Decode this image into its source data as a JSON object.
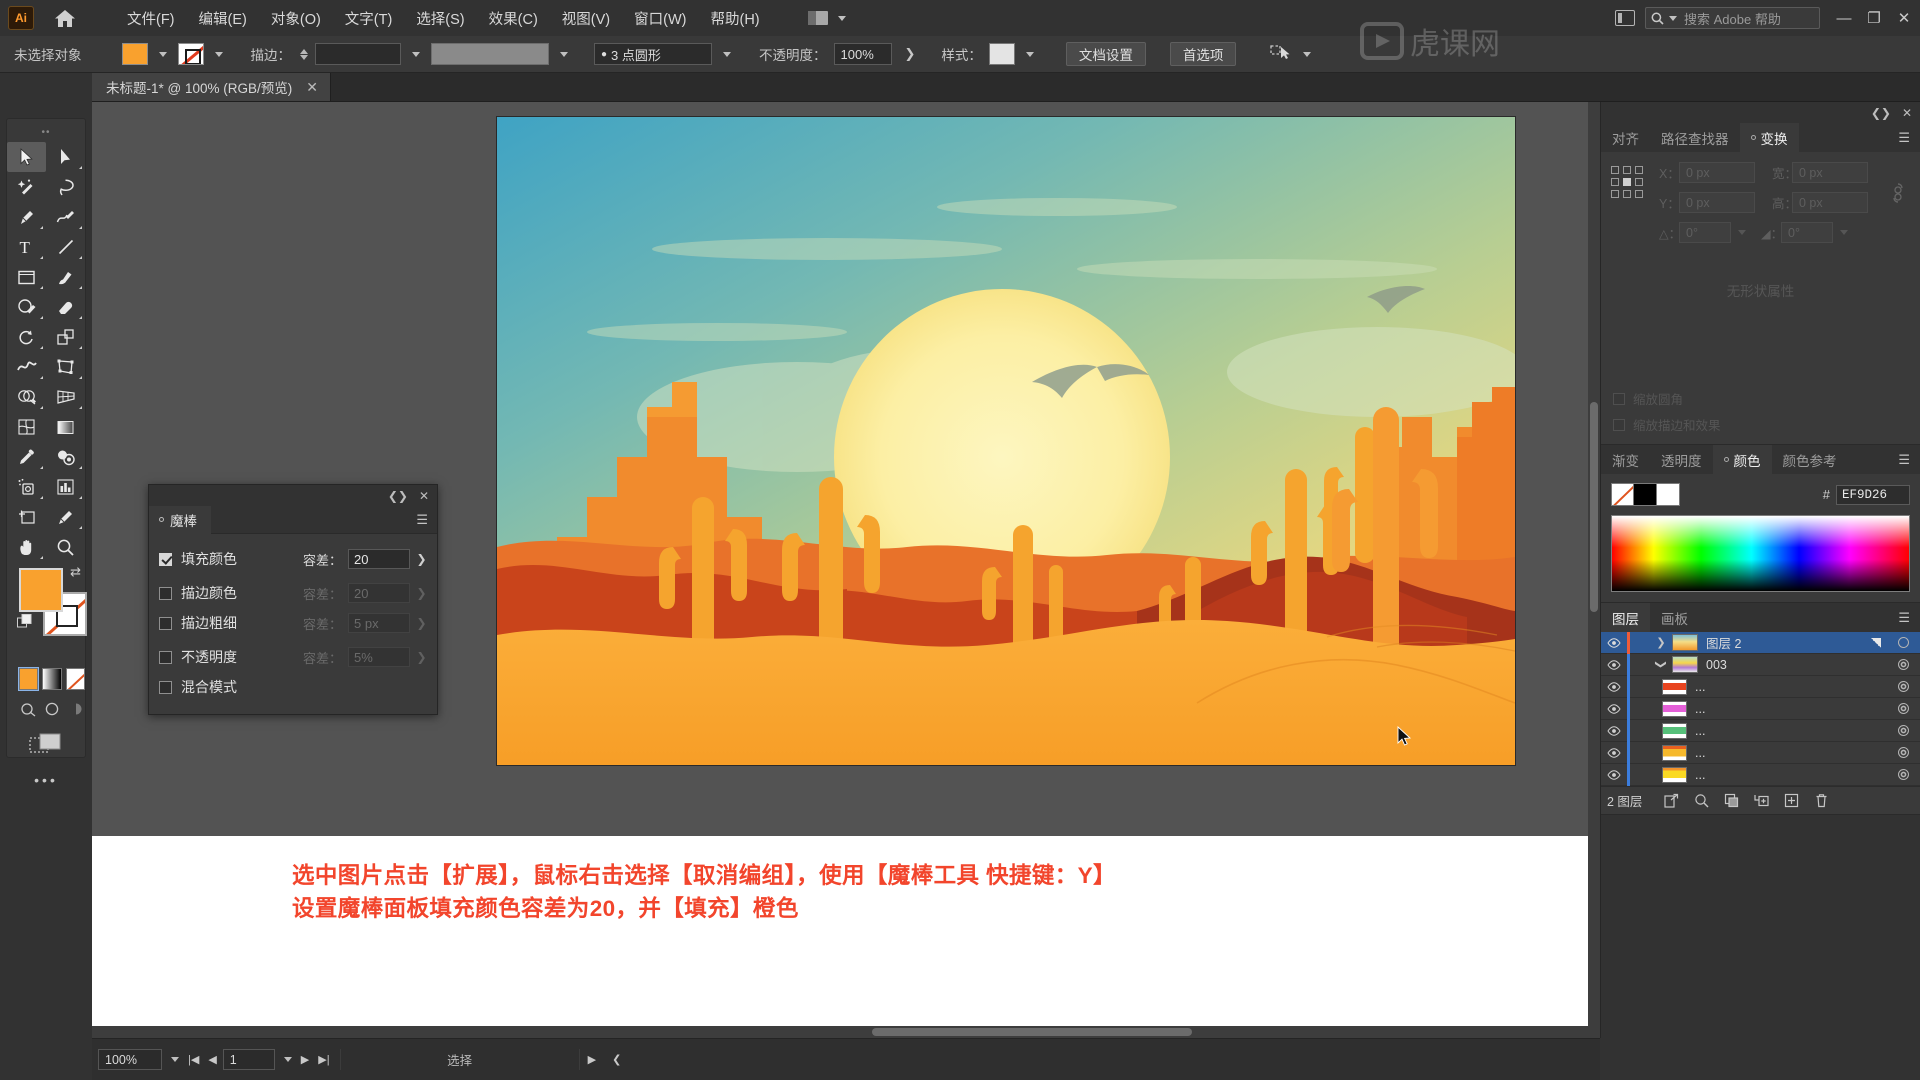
{
  "app": {
    "name": "Ai",
    "logo_label": "Ai"
  },
  "menubar": {
    "items": [
      {
        "label": "文件(F)"
      },
      {
        "label": "编辑(E)"
      },
      {
        "label": "对象(O)"
      },
      {
        "label": "文字(T)"
      },
      {
        "label": "选择(S)"
      },
      {
        "label": "效果(C)"
      },
      {
        "label": "视图(V)"
      },
      {
        "label": "窗口(W)"
      },
      {
        "label": "帮助(H)"
      }
    ],
    "search_placeholder": "搜索 Adobe 帮助",
    "minimize": "—",
    "restore": "❐",
    "close": "✕"
  },
  "controlbar": {
    "selection_status": "未选择对象",
    "stroke_label": "描边：",
    "stroke_weight": "",
    "stroke_profile": "",
    "brush_definition": "3 点圆形",
    "opacity_label": "不透明度：",
    "opacity_value": "100%",
    "style_label": "样式：",
    "document_setup": "文档设置",
    "preferences": "首选项"
  },
  "tabbar": {
    "document_tab": "未标题-1* @ 100% (RGB/预览)",
    "close_glyph": "✕"
  },
  "toolbar": {
    "tools": [
      "selection-tool",
      "direct-selection-tool",
      "magic-wand-tool",
      "lasso-tool",
      "pen-tool",
      "curvature-tool",
      "type-tool",
      "line-segment-tool",
      "rectangle-tool",
      "paintbrush-tool",
      "shaper-tool",
      "eraser-tool",
      "rotate-tool",
      "scale-tool",
      "width-tool",
      "free-transform-tool",
      "shape-builder-tool",
      "perspective-grid-tool",
      "mesh-tool",
      "gradient-tool",
      "eyedropper-tool",
      "blend-tool",
      "symbol-sprayer-tool",
      "column-graph-tool",
      "artboard-tool",
      "slice-tool",
      "hand-tool",
      "zoom-tool"
    ],
    "fill_color": "#F9A12E",
    "stroke_color": "#FFFFFF",
    "more_tools": "•••"
  },
  "magic_wand_panel": {
    "title": "魔棒",
    "collapse_glyph": "❮❯",
    "close_glyph": "✕",
    "menu_glyph": "☰",
    "rows": [
      {
        "label": "填充颜色",
        "checked": true,
        "tolerance_label": "容差：",
        "tolerance_value": "20",
        "enabled": true
      },
      {
        "label": "描边颜色",
        "checked": false,
        "tolerance_label": "容差：",
        "tolerance_value": "20",
        "enabled": false
      },
      {
        "label": "描边粗细",
        "checked": false,
        "tolerance_label": "容差：",
        "tolerance_value": "5 px",
        "enabled": false
      },
      {
        "label": "不透明度",
        "checked": false,
        "tolerance_label": "容差：",
        "tolerance_value": "5%",
        "enabled": false
      },
      {
        "label": "混合模式",
        "checked": false,
        "tolerance_label": "",
        "tolerance_value": "",
        "enabled": false
      }
    ]
  },
  "transform_panel": {
    "tabs": [
      {
        "label": "对齐",
        "active": false
      },
      {
        "label": "路径查找器",
        "active": false
      },
      {
        "label": "变换",
        "active": true
      }
    ],
    "menu_glyph": "☰",
    "close_glyph": "✕",
    "collapse_glyph": "❮❯",
    "fields": {
      "x_label": "X：",
      "x_value": "0 px",
      "y_label": "Y：",
      "y_value": "0 px",
      "w_label": "宽：",
      "w_value": "0 px",
      "h_label": "高：",
      "h_value": "0 px",
      "angle_label": "△：",
      "angle_value": "0°",
      "shear_label": "◢：",
      "shear_value": "0°"
    },
    "no_shape_text": "无形状属性",
    "checkboxes": [
      {
        "label": "缩放圆角",
        "checked": false
      },
      {
        "label": "缩放描边和效果",
        "checked": false
      }
    ]
  },
  "color_panel": {
    "tabs": [
      {
        "label": "渐变",
        "active": false
      },
      {
        "label": "透明度",
        "active": false
      },
      {
        "label": "颜色",
        "active": true
      },
      {
        "label": "颜色参考",
        "active": false
      }
    ],
    "menu_glyph": "☰",
    "hash_symbol": "#",
    "hex_value": "EF9D26",
    "swatches": [
      "none",
      "black",
      "white"
    ]
  },
  "layers_panel": {
    "tabs": [
      {
        "label": "图层",
        "active": true
      },
      {
        "label": "画板",
        "active": false
      }
    ],
    "menu_glyph": "☰",
    "rows": [
      {
        "name": "图层 2",
        "selected": true,
        "indent": 0,
        "color": "#ef5c3a",
        "thumb": "artwork",
        "has_disclosure": true,
        "expanded": false
      },
      {
        "name": "003",
        "selected": false,
        "indent": 1,
        "color": "#3b7ddd",
        "thumb": "group",
        "has_disclosure": true,
        "expanded": true
      },
      {
        "name": "...",
        "selected": false,
        "indent": 2,
        "color": "#3b7ddd",
        "thumb": "swatch-red",
        "has_disclosure": false,
        "expanded": false
      },
      {
        "name": "...",
        "selected": false,
        "indent": 2,
        "color": "#3b7ddd",
        "thumb": "swatch-magenta",
        "has_disclosure": false,
        "expanded": false
      },
      {
        "name": "...",
        "selected": false,
        "indent": 2,
        "color": "#3b7ddd",
        "thumb": "swatch-green",
        "has_disclosure": false,
        "expanded": false
      },
      {
        "name": "...",
        "selected": false,
        "indent": 2,
        "color": "#3b7ddd",
        "thumb": "swatch-orange",
        "has_disclosure": false,
        "expanded": false
      },
      {
        "name": "...",
        "selected": false,
        "indent": 2,
        "color": "#3b7ddd",
        "thumb": "swatch-yellow",
        "has_disclosure": false,
        "expanded": false
      }
    ],
    "footer": {
      "count_label": "2 图层",
      "icons": [
        "locate-object-icon",
        "search-icon",
        "make-clipping-mask-icon",
        "create-sublayer-icon",
        "create-new-layer-icon",
        "delete-layer-icon"
      ]
    }
  },
  "statusbar": {
    "zoom_value": "100%",
    "page_value": "1",
    "status_text": "选择",
    "first_glyph": "|◀",
    "prev_glyph": "◀",
    "next_glyph": "▶",
    "last_glyph": "▶|",
    "expand_glyph": "▶",
    "collapse_glyph": "❮"
  },
  "annotation": {
    "line1": "选中图片点击【扩展】，鼠标右击选择【取消编组】，使用【魔棒工具 快捷键：Y】",
    "line2": "设置魔棒面板填充颜色容差为20，并【填充】橙色",
    "color": "#F2452C"
  },
  "artwork": {
    "title": "desert-sunset-illustration",
    "palette": {
      "sky_top": "#3FA3C4",
      "sky_mid": "#8FC3A8",
      "sky_low": "#F0D97A",
      "sun": "#FCF3B0",
      "sand_front": "#F9A12E",
      "mesa_light": "#F79030",
      "mesa_mid": "#E8722A",
      "mesa_dark": "#C9441B",
      "cactus": "#F5A42E",
      "bird": "#8F9A8A"
    }
  }
}
